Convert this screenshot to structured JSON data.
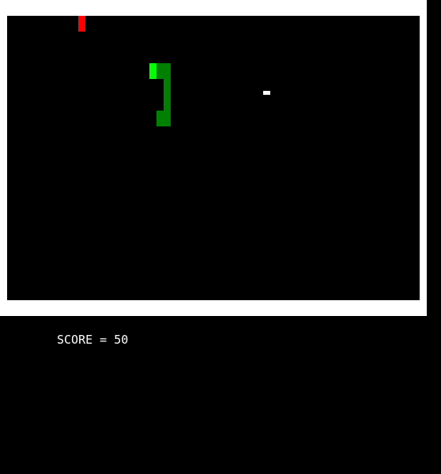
{
  "score_text": "SCORE = 50",
  "score_value": 50,
  "colors": {
    "board_background": "#000000",
    "frame_border": "#ffffff",
    "snake_head": "#00ff00",
    "snake_body": "#008000",
    "food": "#ff0000",
    "bonus_item": "#ffffff",
    "score_text": "#ffffff"
  }
}
